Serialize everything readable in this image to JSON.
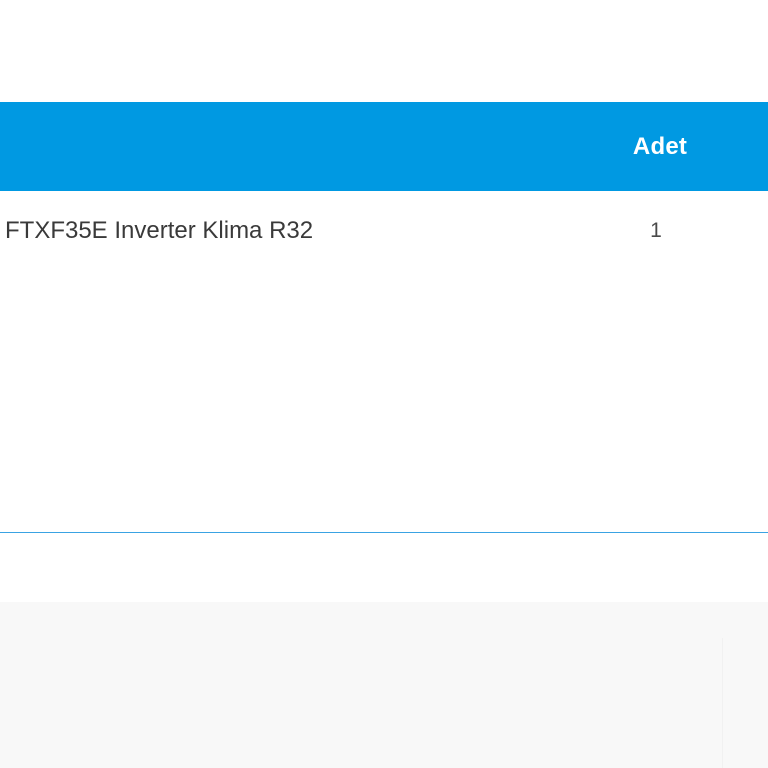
{
  "table": {
    "header": {
      "qty_label": "Adet"
    },
    "rows": [
      {
        "product_name": "FTXF35E Inverter Klima R32",
        "qty": "1"
      }
    ]
  },
  "colors": {
    "header_background": "#0099e2",
    "header_text": "#ffffff",
    "body_text": "#3a3a3a",
    "border_accent": "#3aa3e3",
    "footer_background": "#f8f8f8"
  }
}
